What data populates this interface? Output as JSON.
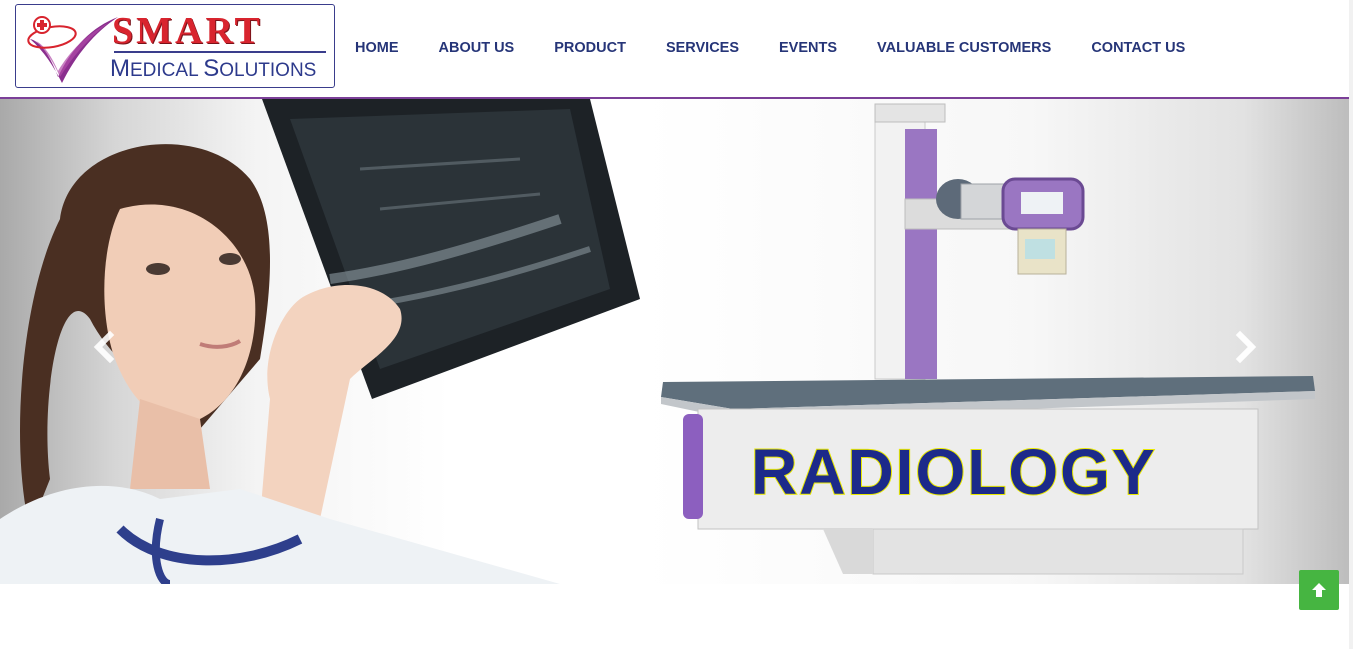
{
  "brand": {
    "title": "SMART",
    "subtitle_parts": [
      "M",
      "EDICAL ",
      "S",
      "OLUTIONS"
    ],
    "colors": {
      "red": "#d8242e",
      "navy": "#2d3a8c",
      "purple": "#7b3f98"
    }
  },
  "nav": {
    "items": [
      {
        "label": "HOME"
      },
      {
        "label": "ABOUT US"
      },
      {
        "label": "PRODUCT"
      },
      {
        "label": "SERVICES"
      },
      {
        "label": "EVENTS"
      },
      {
        "label": "VALUABLE CUSTOMERS"
      },
      {
        "label": "CONTACT US"
      }
    ],
    "color": "#263578"
  },
  "carousel": {
    "slide_caption": "RADIOLOGY",
    "prev_icon": "chevron-left-icon",
    "next_icon": "chevron-right-icon"
  },
  "back_to_top": {
    "icon": "arrow-up-icon",
    "color": "#46b541"
  }
}
